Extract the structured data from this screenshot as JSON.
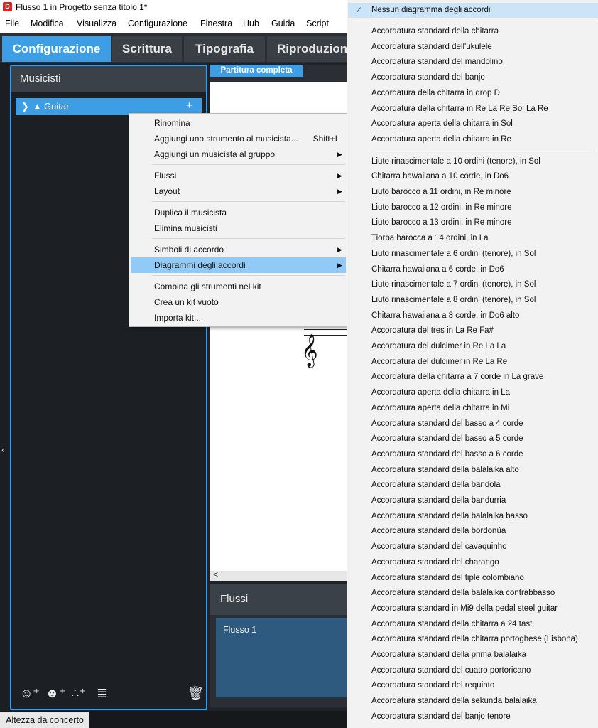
{
  "window": {
    "title": "Flusso 1 in Progetto senza titolo 1*",
    "icon": "dorico-logo-icon"
  },
  "menubar": {
    "items": [
      "File",
      "Modifica",
      "Visualizza",
      "Configurazione",
      "Finestra",
      "Hub",
      "Guida",
      "Script"
    ]
  },
  "modes": {
    "items": [
      "Configurazione",
      "Scrittura",
      "Tipografia",
      "Riproduzion"
    ],
    "active": "Configurazione"
  },
  "players_panel": {
    "title": "Musicisti",
    "player": {
      "name": "Guitar",
      "expand_icon": "chevron-right-icon",
      "type_icon": "person-icon",
      "add_icon": "plus-icon"
    },
    "bottom_icons": [
      "add-solo-player-icon",
      "add-section-player-icon",
      "add-ensemble-icon",
      "add-group-icon",
      "delete-icon"
    ]
  },
  "score": {
    "tab": "Partitura completa",
    "clef_icon": "treble-clef-icon",
    "scroll_left": "<"
  },
  "flows_panel": {
    "title": "Flussi",
    "flow": "Flusso 1"
  },
  "statusbar": {
    "concert_pitch": "Altezza da concerto"
  },
  "context_menu": {
    "items": [
      {
        "label": "Rinomina"
      },
      {
        "label": "Aggiungi uno strumento al musicista...",
        "shortcut": "Shift+I"
      },
      {
        "label": "Aggiungi un musicista al gruppo",
        "submenu": "▶"
      },
      {
        "label": "Flussi",
        "submenu": "▶"
      },
      {
        "label": "Layout",
        "submenu": "▶"
      },
      {
        "label": "Duplica il musicista"
      },
      {
        "label": "Elimina musicisti"
      },
      {
        "label": "Simboli di accordo",
        "submenu": "▶"
      },
      {
        "label": "Diagrammi degli accordi",
        "submenu": "▶",
        "highlighted": true
      },
      {
        "label": "Combina gli strumenti nel kit"
      },
      {
        "label": "Crea un kit vuoto"
      },
      {
        "label": "Importa kit..."
      }
    ]
  },
  "submenu": {
    "checked_index": 0,
    "items": [
      "Nessun diagramma degli accordi",
      "Accordatura standard della chitarra",
      "Accordatura standard dell'ukulele",
      "Accordatura standard del mandolino",
      "Accordatura standard del banjo",
      "Accordatura della chitarra in drop D",
      "Accordatura della chitarra in Re La Re Sol La Re",
      "Accordatura aperta della chitarra in Sol",
      "Accordatura aperta della chitarra in Re",
      "Liuto rinascimentale a 10 ordini (tenore), in Sol",
      "Chitarra hawaiiana a 10 corde, in Do6",
      "Liuto barocco a 11 ordini, in Re minore",
      "Liuto barocco a 12 ordini, in Re minore",
      "Liuto barocco a 13 ordini, in Re minore",
      "Tiorba barocca a 14 ordini, in La",
      "Liuto rinascimentale a 6 ordini (tenore), in Sol",
      "Chitarra hawaiiana a 6 corde, in Do6",
      "Liuto rinascimentale a 7 ordini (tenore), in Sol",
      "Liuto rinascimentale a 8 ordini (tenore), in Sol",
      "Chitarra hawaiiana a 8 corde, in Do6 alto",
      "Accordatura del tres in La Re Fa#",
      "Accordatura del dulcimer in Re La La",
      "Accordatura del dulcimer in Re La Re",
      "Accordatura della chitarra a 7 corde in La grave",
      "Accordatura aperta della chitarra in La",
      "Accordatura aperta della chitarra in Mi",
      "Accordatura standard del basso a 4 corde",
      "Accordatura standard del basso a 5 corde",
      "Accordatura standard del basso a 6 corde",
      "Accordatura standard della balalaika alto",
      "Accordatura standard della bandola",
      "Accordatura standard della bandurria",
      "Accordatura standard della balalaika basso",
      "Accordatura standard della bordonúa",
      "Accordatura standard del cavaquinho",
      "Accordatura standard del charango",
      "Accordatura standard del tiple colombiano",
      "Accordatura standard della balalaika contrabbasso",
      "Accordatura standard in Mi9 della pedal steel guitar",
      "Accordatura standard della chitarra a 24 tasti",
      "Accordatura standard della chitarra portoghese (Lisbona)",
      "Accordatura standard della prima balalaika",
      "Accordatura standard del cuatro portoricano",
      "Accordatura standard del requinto",
      "Accordatura standard della sekunda balalaika",
      "Accordatura standard del banjo tenore"
    ]
  },
  "colors": {
    "accent": "#3d9ee6",
    "highlight": "#91c9f7",
    "panel": "#1c1f24"
  }
}
